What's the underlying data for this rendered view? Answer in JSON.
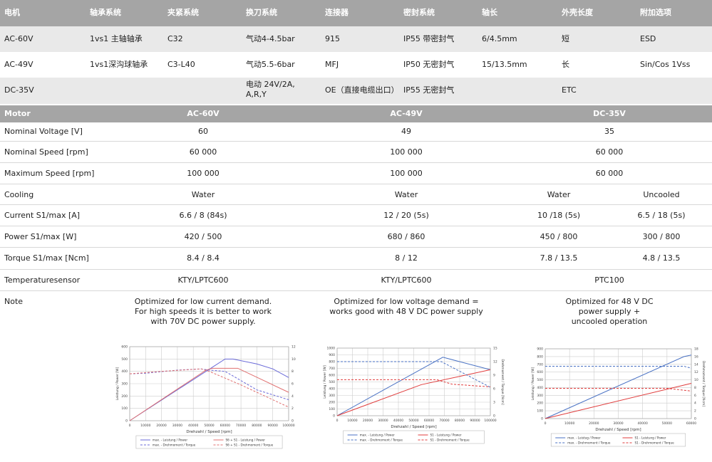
{
  "options_table": {
    "headers": [
      "电机",
      "轴承系统",
      "夹紧系统",
      "换刀系统",
      "连接器",
      "密封系统",
      "轴长",
      "外壳长度",
      "附加选项"
    ],
    "rows": [
      [
        "AC-60V",
        "1vs1 主轴轴承",
        "C32",
        "气动4-4.5bar",
        "915",
        "IP55 带密封气",
        "6/4.5mm",
        "短",
        "ESD"
      ],
      [
        "AC-49V",
        "1vs1深沟球轴承",
        "C3-L40",
        "气动5.5-6bar",
        "MFJ",
        "IP50 无密封气",
        "15/13.5mm",
        "长",
        "Sin/Cos 1Vss"
      ],
      [
        "DC-35V",
        "",
        "",
        "电动 24V/2A,\nA,R,Y",
        "OE（直接电缆出口）",
        "IP55 无密封气",
        "",
        "ETC",
        ""
      ]
    ]
  },
  "spec_table": {
    "headers": [
      "Motor",
      "AC-60V",
      "AC-49V",
      "DC-35V"
    ],
    "rows": [
      {
        "label": "Nominal Voltage [V]",
        "ac60": "60",
        "ac49": "49",
        "dc35": "35"
      },
      {
        "label": "Nominal Speed [rpm]",
        "ac60": "60 000",
        "ac49": "100 000",
        "dc35": "60 000"
      },
      {
        "label": "Maximum Speed [rpm]",
        "ac60": "100 000",
        "ac49": "100 000",
        "dc35": "60 000"
      },
      {
        "label": "Cooling",
        "ac60": "Water",
        "ac49": "Water",
        "dc35a": "Water",
        "dc35b": "Uncooled"
      },
      {
        "label": "Current S1/max [A]",
        "ac60": "6.6 / 8 (84s)",
        "ac49": "12 / 20 (5s)",
        "dc35a": "10 /18 (5s)",
        "dc35b": "6.5 / 18 (5s)"
      },
      {
        "label": "Power S1/max [W]",
        "ac60": "420 / 500",
        "ac49": "680 / 860",
        "dc35a": "450 / 800",
        "dc35b": "300 / 800"
      },
      {
        "label": "Torque S1/max [Ncm]",
        "ac60": "8.4 / 8.4",
        "ac49": "8 / 12",
        "dc35a": "7.8 / 13.5",
        "dc35b": "4.8 / 13.5"
      },
      {
        "label": "Temperaturesensor",
        "ac60": "KTY/LPTC600",
        "ac49": "KTY/LPTC600",
        "dc35": "PTC100"
      },
      {
        "label": "Note",
        "ac60": "Optimized for low current demand.\nFor high speeds it is better to work\nwith 70V DC power supply.",
        "ac49": "Optimized for low voltage demand =\nworks good with 48 V DC power supply",
        "dc35": "Optimized for 48 V DC power supply +\nuncooled operation"
      }
    ]
  },
  "chart_data": [
    {
      "type": "line",
      "xlabel": "Drehzahl / Speed [rpm]",
      "ylabel": "Leistung / Power [W]",
      "y2label": "Drehmoment / Torque [Ncm]",
      "xlim": [
        0,
        100000
      ],
      "ylim": [
        0,
        600
      ],
      "y2lim": [
        0,
        12
      ],
      "xticks": [
        0,
        10000,
        20000,
        30000,
        40000,
        50000,
        60000,
        70000,
        80000,
        90000,
        100000
      ],
      "yticks": [
        0,
        100,
        200,
        300,
        400,
        500,
        600
      ],
      "y2ticks": [
        0,
        2,
        4,
        6,
        8,
        10,
        12
      ],
      "grid": true,
      "legend": "bottom",
      "series": [
        {
          "name": "max. - Leistung / Power",
          "axis": "left",
          "color": "#6a6ad8",
          "dash": false,
          "points": [
            [
              0,
              0
            ],
            [
              60000,
              500
            ],
            [
              65000,
              500
            ],
            [
              80000,
              460
            ],
            [
              90000,
              420
            ],
            [
              100000,
              350
            ]
          ]
        },
        {
          "name": "S6 + S1 - Leistung / Power",
          "axis": "left",
          "color": "#e07070",
          "dash": false,
          "points": [
            [
              0,
              0
            ],
            [
              48000,
              410
            ],
            [
              52000,
              425
            ],
            [
              68000,
              425
            ],
            [
              100000,
              230
            ]
          ]
        },
        {
          "name": "max. - Drehmoment / Torque",
          "axis": "right",
          "color": "#6a6ad8",
          "dash": true,
          "points": [
            [
              0,
              7.6
            ],
            [
              10000,
              7.7
            ],
            [
              30000,
              8.2
            ],
            [
              45000,
              8.4
            ],
            [
              50000,
              8.2
            ],
            [
              60000,
              8
            ],
            [
              80000,
              5
            ],
            [
              100000,
              3.4
            ]
          ]
        },
        {
          "name": "S6 + S1 - Drehmoment / Torque",
          "axis": "right",
          "color": "#e07070",
          "dash": true,
          "points": [
            [
              0,
              7.6
            ],
            [
              20000,
              8
            ],
            [
              45000,
              8.4
            ],
            [
              50000,
              8
            ],
            [
              70000,
              5.8
            ],
            [
              100000,
              2.2
            ]
          ]
        }
      ]
    },
    {
      "type": "line",
      "xlabel": "Drehzahl / Speed [rpm]",
      "ylabel": "Leistung / Power [W]",
      "y2label": "Drehmoment / Torque [Ncm]",
      "xlim": [
        0,
        100000
      ],
      "ylim": [
        0,
        1000
      ],
      "y2lim": [
        0,
        15
      ],
      "xticks": [
        0,
        10000,
        20000,
        30000,
        40000,
        50000,
        60000,
        70000,
        80000,
        90000,
        100000
      ],
      "yticks": [
        0,
        100,
        200,
        300,
        400,
        500,
        600,
        700,
        800,
        900,
        1000
      ],
      "y2ticks": [
        0,
        3,
        6,
        9,
        12,
        15
      ],
      "grid": true,
      "legend": "bottom",
      "series": [
        {
          "name": "max. - Leistung / Power",
          "axis": "left",
          "color": "#4a72c4",
          "dash": false,
          "points": [
            [
              0,
              0
            ],
            [
              69000,
              865
            ],
            [
              100000,
              680
            ]
          ]
        },
        {
          "name": "S1 - Leistung / Power",
          "axis": "left",
          "color": "#e03c3c",
          "dash": false,
          "points": [
            [
              0,
              0
            ],
            [
              55000,
              460
            ],
            [
              100000,
              680
            ]
          ]
        },
        {
          "name": "max. - Drehmoment / Torque",
          "axis": "right",
          "color": "#4a72c4",
          "dash": true,
          "points": [
            [
              0,
              12
            ],
            [
              68000,
              12
            ],
            [
              100000,
              6.3
            ]
          ]
        },
        {
          "name": "S1 - Drehmoment / Torque",
          "axis": "right",
          "color": "#e03c3c",
          "dash": true,
          "points": [
            [
              0,
              8
            ],
            [
              65000,
              8
            ],
            [
              75000,
              7
            ],
            [
              100000,
              6.4
            ]
          ]
        }
      ]
    },
    {
      "type": "line",
      "xlabel": "Drehzahl / Speed [rpm]",
      "ylabel": "Leistung / Power [W]",
      "y2label": "Drehmoment / Torque [Ncm]",
      "xlim": [
        0,
        60000
      ],
      "ylim": [
        0,
        900
      ],
      "y2lim": [
        0,
        18
      ],
      "xticks": [
        0,
        10000,
        20000,
        30000,
        40000,
        50000,
        60000
      ],
      "yticks": [
        0,
        100,
        200,
        300,
        400,
        500,
        600,
        700,
        800,
        900
      ],
      "y2ticks": [
        0,
        2,
        4,
        6,
        8,
        10,
        12,
        14,
        16,
        18
      ],
      "grid": true,
      "legend": "bottom",
      "series": [
        {
          "name": "max. - Leistug / Power",
          "axis": "left",
          "color": "#4a72c4",
          "dash": false,
          "points": [
            [
              0,
              0
            ],
            [
              57000,
              800
            ],
            [
              60000,
              820
            ]
          ]
        },
        {
          "name": "S1 - Leistung / Power",
          "axis": "left",
          "color": "#e03c3c",
          "dash": false,
          "points": [
            [
              0,
              0
            ],
            [
              60000,
              455
            ]
          ]
        },
        {
          "name": "max. - Drehmoment / Torque",
          "axis": "right",
          "color": "#4a72c4",
          "dash": true,
          "points": [
            [
              0,
              13.5
            ],
            [
              57000,
              13.5
            ],
            [
              60000,
              13
            ]
          ]
        },
        {
          "name": "S1 - Drehmoment / Torque",
          "axis": "right",
          "color": "#e03c3c",
          "dash": true,
          "points": [
            [
              0,
              7.8
            ],
            [
              50000,
              7.8
            ],
            [
              60000,
              7.1
            ]
          ]
        }
      ]
    }
  ]
}
